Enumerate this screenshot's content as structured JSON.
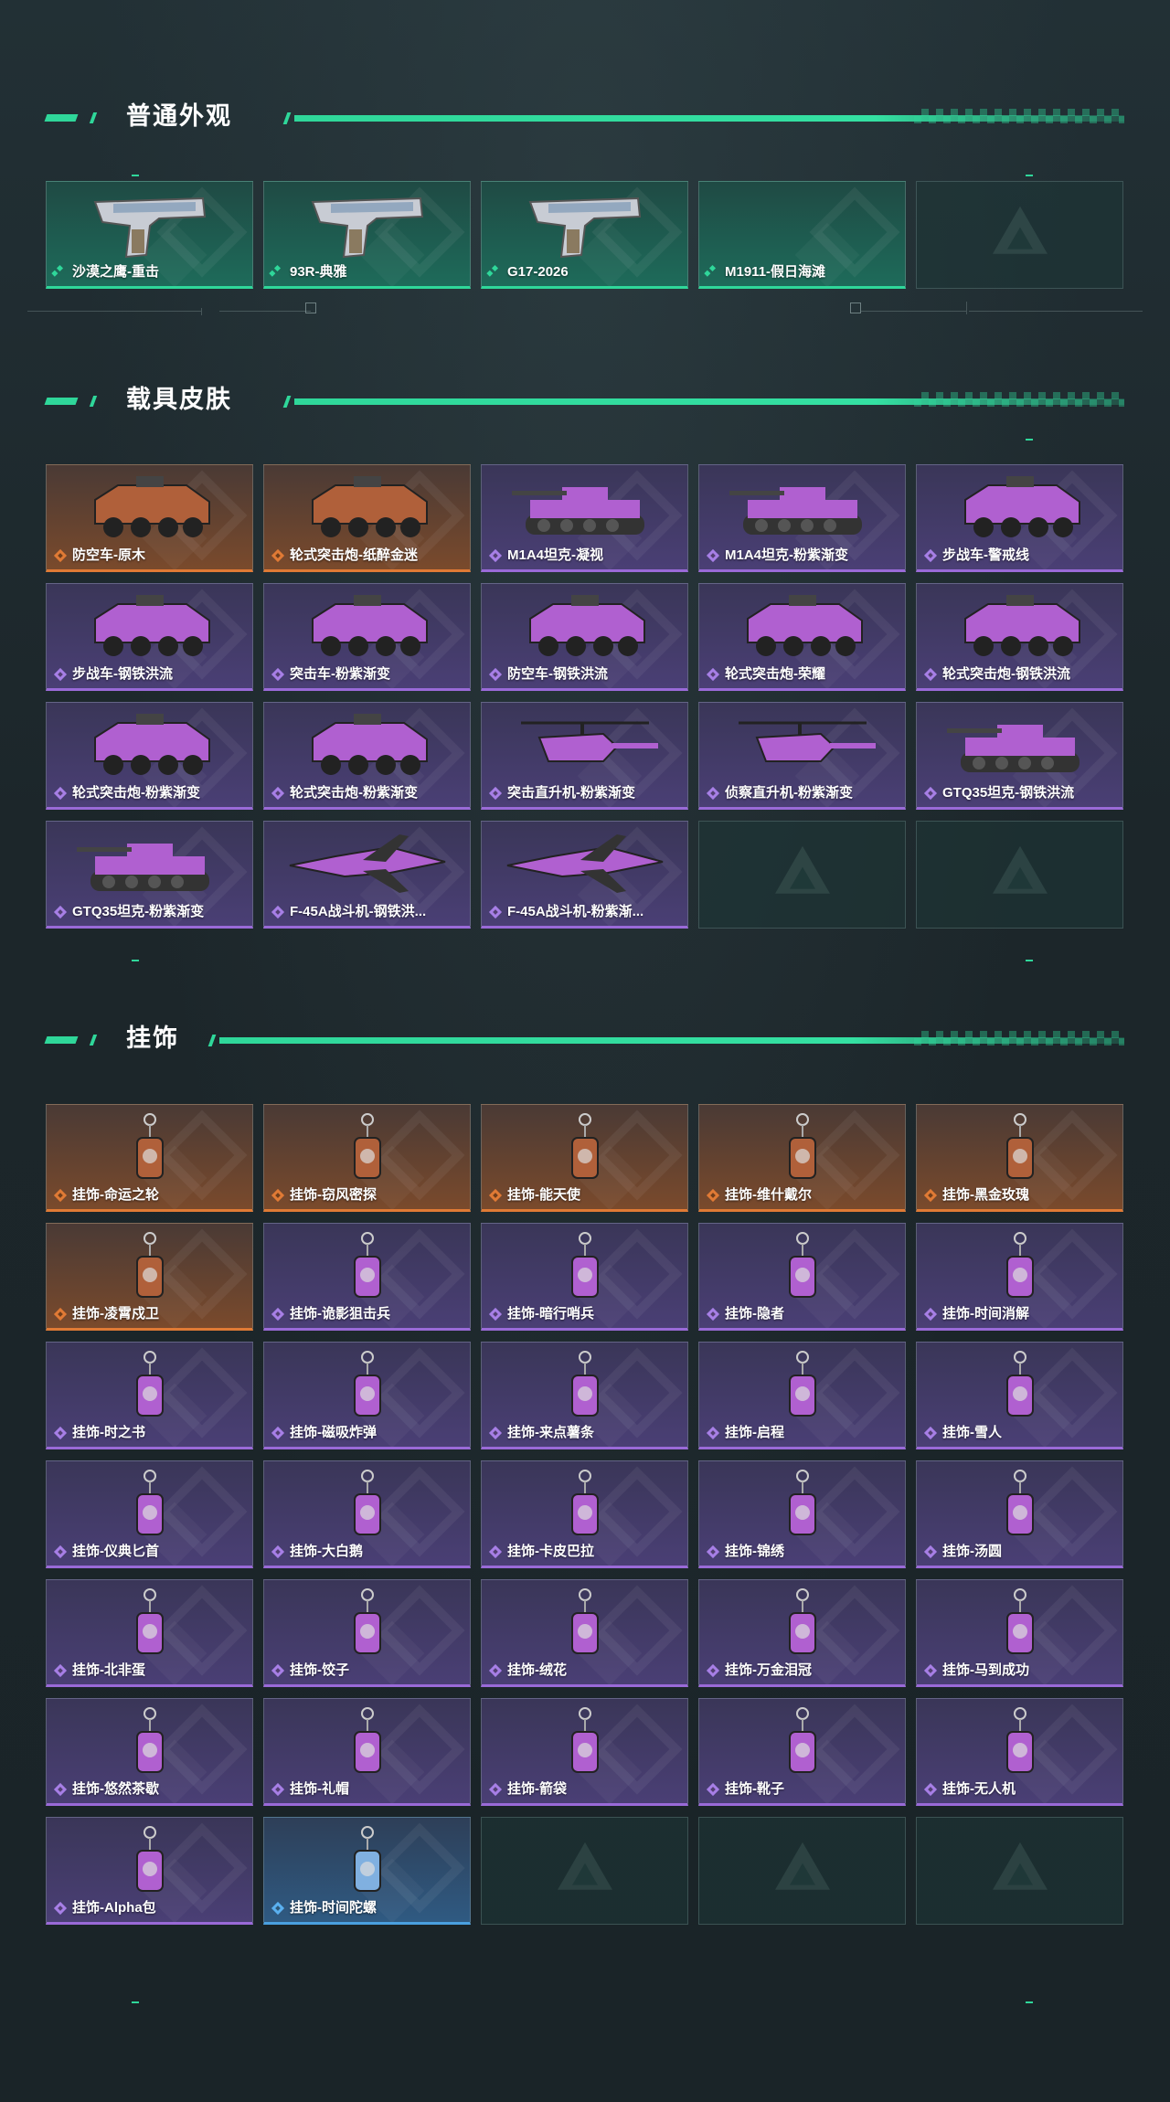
{
  "sections": [
    {
      "title": "普通外观"
    },
    {
      "title": "载具皮肤"
    },
    {
      "title": "挂饰"
    }
  ],
  "weapons": [
    {
      "name": "沙漠之鹰-重击",
      "rarity": "green",
      "icon": "pistol-icon"
    },
    {
      "name": "93R-典雅",
      "rarity": "green",
      "icon": "pistol-icon"
    },
    {
      "name": "G17-2026",
      "rarity": "green",
      "icon": "pistol-icon"
    },
    {
      "name": "M1911-假日海滩",
      "rarity": "green",
      "icon": ""
    },
    {
      "name": "",
      "rarity": "empty",
      "icon": ""
    }
  ],
  "vehicles": [
    {
      "name": "防空车-原木",
      "rarity": "orange",
      "icon": "armored-vehicle-icon"
    },
    {
      "name": "轮式突击炮-纸醉金迷",
      "rarity": "orange",
      "icon": "armored-vehicle-icon"
    },
    {
      "name": "M1A4坦克-凝视",
      "rarity": "purple",
      "icon": "tank-icon"
    },
    {
      "name": "M1A4坦克-粉紫渐变",
      "rarity": "purple",
      "icon": "tank-icon"
    },
    {
      "name": "步战车-警戒线",
      "rarity": "purple",
      "icon": "armored-vehicle-icon"
    },
    {
      "name": "步战车-钢铁洪流",
      "rarity": "purple",
      "icon": "armored-vehicle-icon"
    },
    {
      "name": "突击车-粉紫渐变",
      "rarity": "purple",
      "icon": "armored-vehicle-icon"
    },
    {
      "name": "防空车-钢铁洪流",
      "rarity": "purple",
      "icon": "armored-vehicle-icon"
    },
    {
      "name": "轮式突击炮-荣耀",
      "rarity": "purple",
      "icon": "armored-vehicle-icon"
    },
    {
      "name": "轮式突击炮-钢铁洪流",
      "rarity": "purple",
      "icon": "armored-vehicle-icon"
    },
    {
      "name": "轮式突击炮-粉紫渐变",
      "rarity": "purple",
      "icon": "armored-vehicle-icon"
    },
    {
      "name": "轮式突击炮-粉紫渐变",
      "rarity": "purple",
      "icon": "armored-vehicle-icon"
    },
    {
      "name": "突击直升机-粉紫渐变",
      "rarity": "purple",
      "icon": "helicopter-icon"
    },
    {
      "name": "侦察直升机-粉紫渐变",
      "rarity": "purple",
      "icon": "helicopter-icon"
    },
    {
      "name": "GTQ35坦克-钢铁洪流",
      "rarity": "purple",
      "icon": "tank-icon"
    },
    {
      "name": "GTQ35坦克-粉紫渐变",
      "rarity": "purple",
      "icon": "tank-icon"
    },
    {
      "name": "F-45A战斗机-钢铁洪...",
      "rarity": "purple",
      "icon": "jet-icon"
    },
    {
      "name": "F-45A战斗机-粉紫渐...",
      "rarity": "purple",
      "icon": "jet-icon"
    },
    {
      "name": "",
      "rarity": "empty",
      "icon": ""
    },
    {
      "name": "",
      "rarity": "empty",
      "icon": ""
    }
  ],
  "charms": [
    {
      "name": "挂饰-命运之轮",
      "rarity": "orange",
      "icon": "charm-icon"
    },
    {
      "name": "挂饰-窃风密探",
      "rarity": "orange",
      "icon": "charm-icon"
    },
    {
      "name": "挂饰-能天使",
      "rarity": "orange",
      "icon": "charm-icon"
    },
    {
      "name": "挂饰-维什戴尔",
      "rarity": "orange",
      "icon": "charm-icon"
    },
    {
      "name": "挂饰-黑金玫瑰",
      "rarity": "orange",
      "icon": "charm-icon"
    },
    {
      "name": "挂饰-凌霄戍卫",
      "rarity": "orange",
      "icon": "charm-icon"
    },
    {
      "name": "挂饰-诡影狙击兵",
      "rarity": "purple",
      "icon": "charm-icon"
    },
    {
      "name": "挂饰-暗行哨兵",
      "rarity": "purple",
      "icon": "charm-icon"
    },
    {
      "name": "挂饰-隐者",
      "rarity": "purple",
      "icon": "charm-icon"
    },
    {
      "name": "挂饰-时间消解",
      "rarity": "purple",
      "icon": "charm-icon"
    },
    {
      "name": "挂饰-时之书",
      "rarity": "purple",
      "icon": "charm-icon"
    },
    {
      "name": "挂饰-磁吸炸弹",
      "rarity": "purple",
      "icon": "charm-icon"
    },
    {
      "name": "挂饰-来点薯条",
      "rarity": "purple",
      "icon": "charm-icon"
    },
    {
      "name": "挂饰-启程",
      "rarity": "purple",
      "icon": "charm-icon"
    },
    {
      "name": "挂饰-雪人",
      "rarity": "purple",
      "icon": "charm-icon"
    },
    {
      "name": "挂饰-仪典匕首",
      "rarity": "purple",
      "icon": "charm-icon"
    },
    {
      "name": "挂饰-大白鹅",
      "rarity": "purple",
      "icon": "charm-icon"
    },
    {
      "name": "挂饰-卡皮巴拉",
      "rarity": "purple",
      "icon": "charm-icon"
    },
    {
      "name": "挂饰-锦绣",
      "rarity": "purple",
      "icon": "charm-icon"
    },
    {
      "name": "挂饰-汤圆",
      "rarity": "purple",
      "icon": "charm-icon"
    },
    {
      "name": "挂饰-北非蛋",
      "rarity": "purple",
      "icon": "charm-icon"
    },
    {
      "name": "挂饰-饺子",
      "rarity": "purple",
      "icon": "charm-icon"
    },
    {
      "name": "挂饰-绒花",
      "rarity": "purple",
      "icon": "charm-icon"
    },
    {
      "name": "挂饰-万金泪冠",
      "rarity": "purple",
      "icon": "charm-icon"
    },
    {
      "name": "挂饰-马到成功",
      "rarity": "purple",
      "icon": "charm-icon"
    },
    {
      "name": "挂饰-悠然茶歇",
      "rarity": "purple",
      "icon": "charm-icon"
    },
    {
      "name": "挂饰-礼帽",
      "rarity": "purple",
      "icon": "charm-icon"
    },
    {
      "name": "挂饰-箭袋",
      "rarity": "purple",
      "icon": "charm-icon"
    },
    {
      "name": "挂饰-靴子",
      "rarity": "purple",
      "icon": "charm-icon"
    },
    {
      "name": "挂饰-无人机",
      "rarity": "purple",
      "icon": "charm-icon"
    },
    {
      "name": "挂饰-Alpha包",
      "rarity": "purple",
      "icon": "charm-icon"
    },
    {
      "name": "挂饰-时间陀螺",
      "rarity": "blue",
      "icon": "charm-icon"
    },
    {
      "name": "",
      "rarity": "empty",
      "icon": ""
    },
    {
      "name": "",
      "rarity": "empty",
      "icon": ""
    },
    {
      "name": "",
      "rarity": "empty",
      "icon": ""
    }
  ],
  "colors": {
    "accent": "#2fd79a",
    "orange": "#e07a35",
    "purple": "#9a6ad8",
    "blue": "#4aa0e0"
  }
}
